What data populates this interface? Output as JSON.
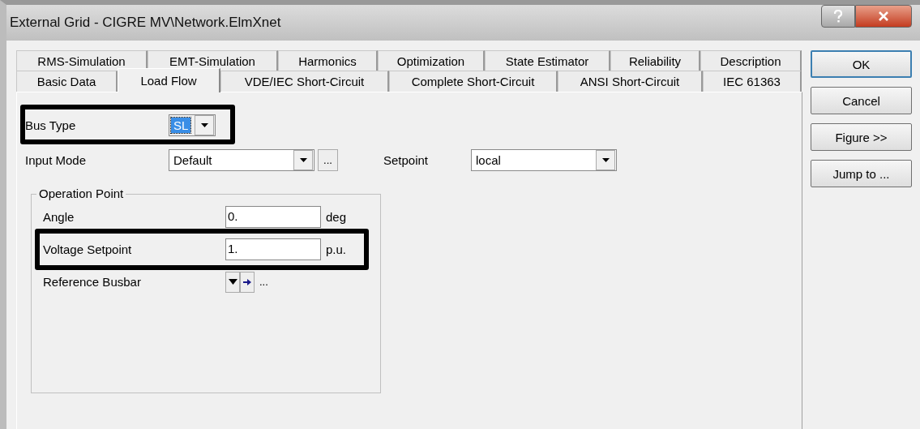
{
  "window": {
    "title": "External Grid - CIGRE MV\\Network.ElmXnet"
  },
  "tabs": {
    "top_row": [
      {
        "label": "RMS-Simulation",
        "selected": false
      },
      {
        "label": "EMT-Simulation",
        "selected": false
      },
      {
        "label": "Harmonics",
        "selected": false
      },
      {
        "label": "Optimization",
        "selected": false
      },
      {
        "label": "State Estimator",
        "selected": false
      },
      {
        "label": "Reliability",
        "selected": false
      },
      {
        "label": "Description",
        "selected": false
      }
    ],
    "bottom_row": [
      {
        "label": "Basic Data",
        "selected": false
      },
      {
        "label": "Load Flow",
        "selected": true
      },
      {
        "label": "VDE/IEC Short-Circuit",
        "selected": false
      },
      {
        "label": "Complete Short-Circuit",
        "selected": false
      },
      {
        "label": "ANSI Short-Circuit",
        "selected": false
      },
      {
        "label": "IEC 61363",
        "selected": false
      }
    ]
  },
  "bus_type": {
    "label": "Bus Type",
    "value": "SL",
    "highlighted": true
  },
  "input_mode": {
    "label": "Input Mode",
    "value": "Default",
    "more": "..."
  },
  "setpoint": {
    "label": "Setpoint",
    "value": "local"
  },
  "operation_point": {
    "title": "Operation Point",
    "rows": [
      {
        "kind": "number",
        "label": "Angle",
        "value": "0.",
        "unit": "deg",
        "highlighted": false
      },
      {
        "kind": "number",
        "label": "Voltage Setpoint",
        "value": "1.",
        "unit": "p.u.",
        "highlighted": true
      },
      {
        "kind": "reference",
        "label": "Reference Busbar",
        "more": "..."
      }
    ]
  },
  "buttons": [
    "OK",
    "Cancel",
    "Figure >>",
    "Jump to ..."
  ]
}
